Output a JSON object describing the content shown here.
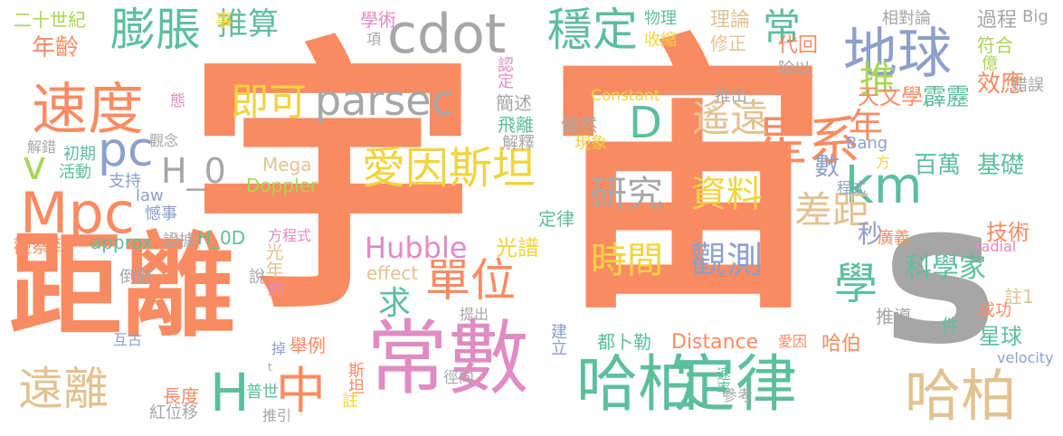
{
  "palette": {
    "orange": "#F98B62",
    "teal": "#5CBF9B",
    "gray": "#A6A6A6",
    "blue": "#8D9FCB",
    "pink": "#E08BC3",
    "yellow": "#F2D33E",
    "tan": "#E2C290",
    "lime": "#A8D653"
  },
  "words": [
    {
      "text": "宇",
      "color": "#F98B62"
    },
    {
      "text": "宙",
      "color": "#F98B62"
    },
    {
      "text": "距離",
      "color": "#F98B62"
    },
    {
      "text": "常數",
      "color": "#E08BC3"
    },
    {
      "text": "s",
      "color": "#A6A6A6"
    },
    {
      "text": "定律",
      "color": "#5CBF9B"
    },
    {
      "text": "哈柏",
      "color": "#5CBF9B"
    },
    {
      "text": "哈柏",
      "color": "#E2C290"
    },
    {
      "text": "Mpc",
      "color": "#F98B62"
    },
    {
      "text": "速度",
      "color": "#F98B62"
    },
    {
      "text": "地球",
      "color": "#8D9FCB"
    },
    {
      "text": "星系",
      "color": "#F98B62"
    },
    {
      "text": "cdot",
      "color": "#A6A6A6"
    },
    {
      "text": "穩定",
      "color": "#5CBF9B"
    },
    {
      "text": "膨脹",
      "color": "#5CBF9B"
    },
    {
      "text": "遠離",
      "color": "#E2C290"
    },
    {
      "text": "愛因斯坦",
      "color": "#F2D33E"
    },
    {
      "text": "km",
      "color": "#5CBF9B"
    },
    {
      "text": "單位",
      "color": "#F98B62"
    },
    {
      "text": "中",
      "color": "#F98B62"
    },
    {
      "text": "H",
      "color": "#5CBF9B"
    },
    {
      "text": "學",
      "color": "#5CBF9B"
    },
    {
      "text": "pc",
      "color": "#8D9FCB"
    },
    {
      "text": "v",
      "color": "#A8D653"
    },
    {
      "text": "D",
      "color": "#5CBF9B"
    },
    {
      "text": "parsec",
      "color": "#A6A6A6"
    },
    {
      "text": "即可",
      "color": "#F2D33E"
    },
    {
      "text": "遙遠",
      "color": "#E2C290"
    },
    {
      "text": "差距",
      "color": "#E2C290"
    },
    {
      "text": "研究",
      "color": "#A6A6A6"
    },
    {
      "text": "資料",
      "color": "#F2D33E"
    },
    {
      "text": "時間",
      "color": "#F2D33E"
    },
    {
      "text": "觀測",
      "color": "#8D9FCB"
    },
    {
      "text": "Hubble",
      "color": "#E08BC3"
    },
    {
      "text": "H_0",
      "color": "#A6A6A6"
    },
    {
      "text": "推算",
      "color": "#5CBF9B"
    },
    {
      "text": "年齡",
      "color": "#F98B62"
    },
    {
      "text": "常",
      "color": "#5CBF9B"
    },
    {
      "text": "推",
      "color": "#A8D653"
    },
    {
      "text": "年",
      "color": "#F98B62"
    },
    {
      "text": "秒",
      "color": "#8D9FCB"
    },
    {
      "text": "數",
      "color": "#8D9FCB"
    },
    {
      "text": "求",
      "color": "#5CBF9B"
    },
    {
      "text": "科學家",
      "color": "#5CBF9B"
    },
    {
      "text": "星球",
      "color": "#5CBF9B"
    },
    {
      "text": "效應",
      "color": "#F98B62"
    },
    {
      "text": "百萬",
      "color": "#5CBF9B"
    },
    {
      "text": "基礎",
      "color": "#5CBF9B"
    },
    {
      "text": "技術",
      "color": "#F98B62"
    },
    {
      "text": "天文學",
      "color": "#F98B62"
    },
    {
      "text": "霹靂",
      "color": "#5CBF9B"
    },
    {
      "text": "二十世紀",
      "color": "#A8D653"
    },
    {
      "text": "事",
      "color": "#F2D33E"
    },
    {
      "text": "學術",
      "color": "#E08BC3"
    },
    {
      "text": "項",
      "color": "#A6A6A6"
    },
    {
      "text": "物理",
      "color": "#5CBF9B"
    },
    {
      "text": "收縮",
      "color": "#F2D33E"
    },
    {
      "text": "理論",
      "color": "#E2C290"
    },
    {
      "text": "修正",
      "color": "#E2C290"
    },
    {
      "text": "代回",
      "color": "#F98B62"
    },
    {
      "text": "除以",
      "color": "#A6A6A6"
    },
    {
      "text": "相對論",
      "color": "#A6A6A6"
    },
    {
      "text": "過程",
      "color": "#A6A6A6"
    },
    {
      "text": "Big",
      "color": "#A6A6A6"
    },
    {
      "text": "符合",
      "color": "#A8D653"
    },
    {
      "text": "億",
      "color": "#A8D653"
    },
    {
      "text": "錯誤",
      "color": "#A6A6A6"
    },
    {
      "text": "認定",
      "color": "#E08BC3"
    },
    {
      "text": "簡述",
      "color": "#A6A6A6"
    },
    {
      "text": "Constant",
      "color": "#F2D33E"
    },
    {
      "text": "推出",
      "color": "#A6A6A6"
    },
    {
      "text": "態",
      "color": "#E08BC3"
    },
    {
      "text": "飛離",
      "color": "#5CBF9B"
    },
    {
      "text": "儼然",
      "color": "#A6A6A6"
    },
    {
      "text": "解釋",
      "color": "#A6A6A6"
    },
    {
      "text": "現象",
      "color": "#F2D33E"
    },
    {
      "text": "解錯",
      "color": "#A6A6A6"
    },
    {
      "text": "觀念",
      "color": "#A6A6A6"
    },
    {
      "text": "初期",
      "color": "#5CBF9B"
    },
    {
      "text": "活動",
      "color": "#5CBF9B"
    },
    {
      "text": "支持",
      "color": "#8D9FCB"
    },
    {
      "text": "Mega",
      "color": "#E2C290"
    },
    {
      "text": "Doppler",
      "color": "#A8D653"
    },
    {
      "text": "Bang",
      "color": "#8D9FCB"
    },
    {
      "text": "方",
      "color": "#F2D33E"
    },
    {
      "text": "程式",
      "color": "#8D9FCB"
    },
    {
      "text": "law",
      "color": "#8D9FCB"
    },
    {
      "text": "憾事",
      "color": "#8D9FCB"
    },
    {
      "text": "觀察到",
      "color": "#F98B62"
    },
    {
      "text": "approx",
      "color": "#5CBF9B"
    },
    {
      "text": "證據",
      "color": "#A6A6A6"
    },
    {
      "text": "H_0D",
      "color": "#5CBF9B"
    },
    {
      "text": "方程式",
      "color": "#E08BC3"
    },
    {
      "text": "定律",
      "color": "#5CBF9B"
    },
    {
      "text": "光譜",
      "color": "#F2D33E"
    },
    {
      "text": "廣義",
      "color": "#F98B62"
    },
    {
      "text": "radial",
      "color": "#E08BC3"
    },
    {
      "text": "一生",
      "color": "#A6A6A6"
    },
    {
      "text": "註1",
      "color": "#E2C290"
    },
    {
      "text": "倒數",
      "color": "#A6A6A6"
    },
    {
      "text": "說",
      "color": "#A6A6A6"
    },
    {
      "text": "約",
      "color": "#E08BC3"
    },
    {
      "text": "光年",
      "color": "#E2C290"
    },
    {
      "text": "effect",
      "color": "#E2C290"
    },
    {
      "text": "提出",
      "color": "#A6A6A6"
    },
    {
      "text": "推導",
      "color": "#A6A6A6"
    },
    {
      "text": "成功",
      "color": "#F98B62"
    },
    {
      "text": "件",
      "color": "#5CBF9B"
    },
    {
      "text": "互古",
      "color": "#8D9FCB"
    },
    {
      "text": "掉",
      "color": "#8D9FCB"
    },
    {
      "text": "舉例",
      "color": "#F98B62"
    },
    {
      "text": "建立",
      "color": "#8D9FCB"
    },
    {
      "text": "都卜勒",
      "color": "#5CBF9B"
    },
    {
      "text": "Distance",
      "color": "#F98B62"
    },
    {
      "text": "愛因",
      "color": "#F98B62"
    },
    {
      "text": "哈伯",
      "color": "#F98B62"
    },
    {
      "text": "t",
      "color": "#A6A6A6"
    },
    {
      "text": "斯坦",
      "color": "#F98B62"
    },
    {
      "text": "徑向",
      "color": "#A6A6A6"
    },
    {
      "text": "速率",
      "color": "#5CBF9B"
    },
    {
      "text": "velocity",
      "color": "#8D9FCB"
    },
    {
      "text": "長度",
      "color": "#F98B62"
    },
    {
      "text": "普世",
      "color": "#5CBF9B"
    },
    {
      "text": "紅位移",
      "color": "#A6A6A6"
    },
    {
      "text": "註",
      "color": "#F2D33E"
    },
    {
      "text": "參考",
      "color": "#A6A6A6"
    },
    {
      "text": "推引",
      "color": "#A6A6A6"
    }
  ]
}
